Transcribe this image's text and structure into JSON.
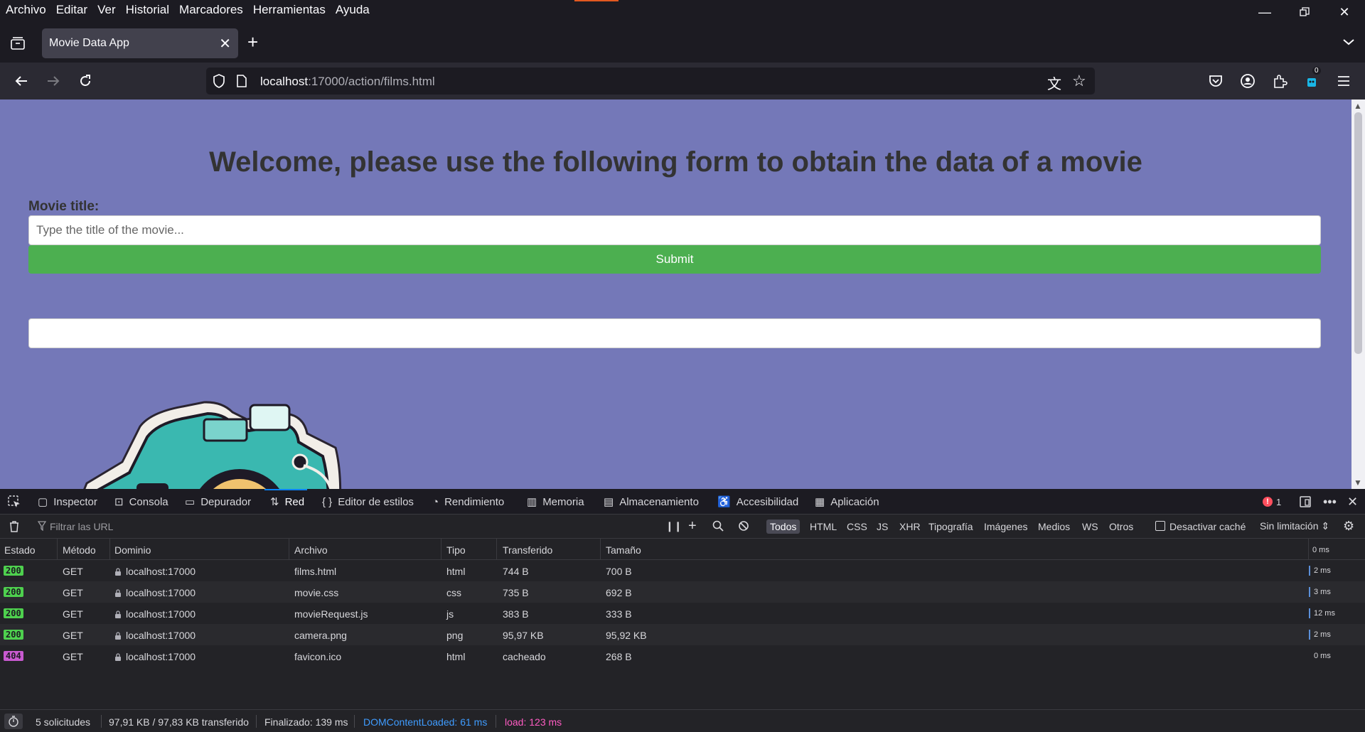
{
  "menubar": {
    "items": [
      "Archivo",
      "Editar",
      "Ver",
      "Historial",
      "Marcadores",
      "Herramientas",
      "Ayuda"
    ]
  },
  "tab": {
    "title": "Movie Data App",
    "close": "✕",
    "new": "+"
  },
  "urlbar": {
    "host": "localhost",
    "rest": ":17000/action/films.html"
  },
  "toolbar": {
    "extension_badge": "0"
  },
  "page": {
    "heading": "Welcome, please use the following form to obtain the data of a movie",
    "movie_label": "Movie title:",
    "movie_placeholder": "Type the title of the movie...",
    "submit_label": "Submit"
  },
  "devtools": {
    "tabs": [
      "Inspector",
      "Consola",
      "Depurador",
      "Red",
      "Editor de estilos",
      "Rendimiento",
      "Memoria",
      "Almacenamiento",
      "Accesibilidad",
      "Aplicación"
    ],
    "error_count": "1",
    "filter_placeholder": "Filtrar las URL",
    "filter_types": [
      "Todos",
      "HTML",
      "CSS",
      "JS",
      "XHR",
      "Tipografía",
      "Imágenes",
      "Medios",
      "WS",
      "Otros"
    ],
    "disable_cache": "Desactivar caché",
    "throttle": "Sin limitación ⇕",
    "columns": [
      "Estado",
      "Método",
      "Dominio",
      "Archivo",
      "Tipo",
      "Transferido",
      "Tamaño"
    ],
    "waterfall_header": "0 ms",
    "rows": [
      {
        "status": "200",
        "method": "GET",
        "domain": "localhost:17000",
        "file": "films.html",
        "type": "html",
        "transferred": "744 B",
        "size": "700 B",
        "time": "2 ms"
      },
      {
        "status": "200",
        "method": "GET",
        "domain": "localhost:17000",
        "file": "movie.css",
        "type": "css",
        "transferred": "735 B",
        "size": "692 B",
        "time": "3 ms"
      },
      {
        "status": "200",
        "method": "GET",
        "domain": "localhost:17000",
        "file": "movieRequest.js",
        "type": "js",
        "transferred": "383 B",
        "size": "333 B",
        "time": "12 ms"
      },
      {
        "status": "200",
        "method": "GET",
        "domain": "localhost:17000",
        "file": "camera.png",
        "type": "png",
        "transferred": "95,97 KB",
        "size": "95,92 KB",
        "time": "2 ms"
      },
      {
        "status": "404",
        "method": "GET",
        "domain": "localhost:17000",
        "file": "favicon.ico",
        "type": "html",
        "transferred": "cacheado",
        "size": "268 B",
        "time": "0 ms"
      }
    ],
    "summary": {
      "requests": "5 solicitudes",
      "transferred": "97,91 KB / 97,83 KB transferido",
      "finished": "Finalizado: 139 ms",
      "dom": "DOMContentLoaded: 61 ms",
      "load": "load: 123 ms"
    }
  },
  "colors": {
    "page_bg": "#7478b8",
    "submit": "#4caf50",
    "status_ok": "#4ed04e",
    "status_404": "#c85ad0",
    "dom": "#3f9cff",
    "load": "#ff5cc3"
  }
}
